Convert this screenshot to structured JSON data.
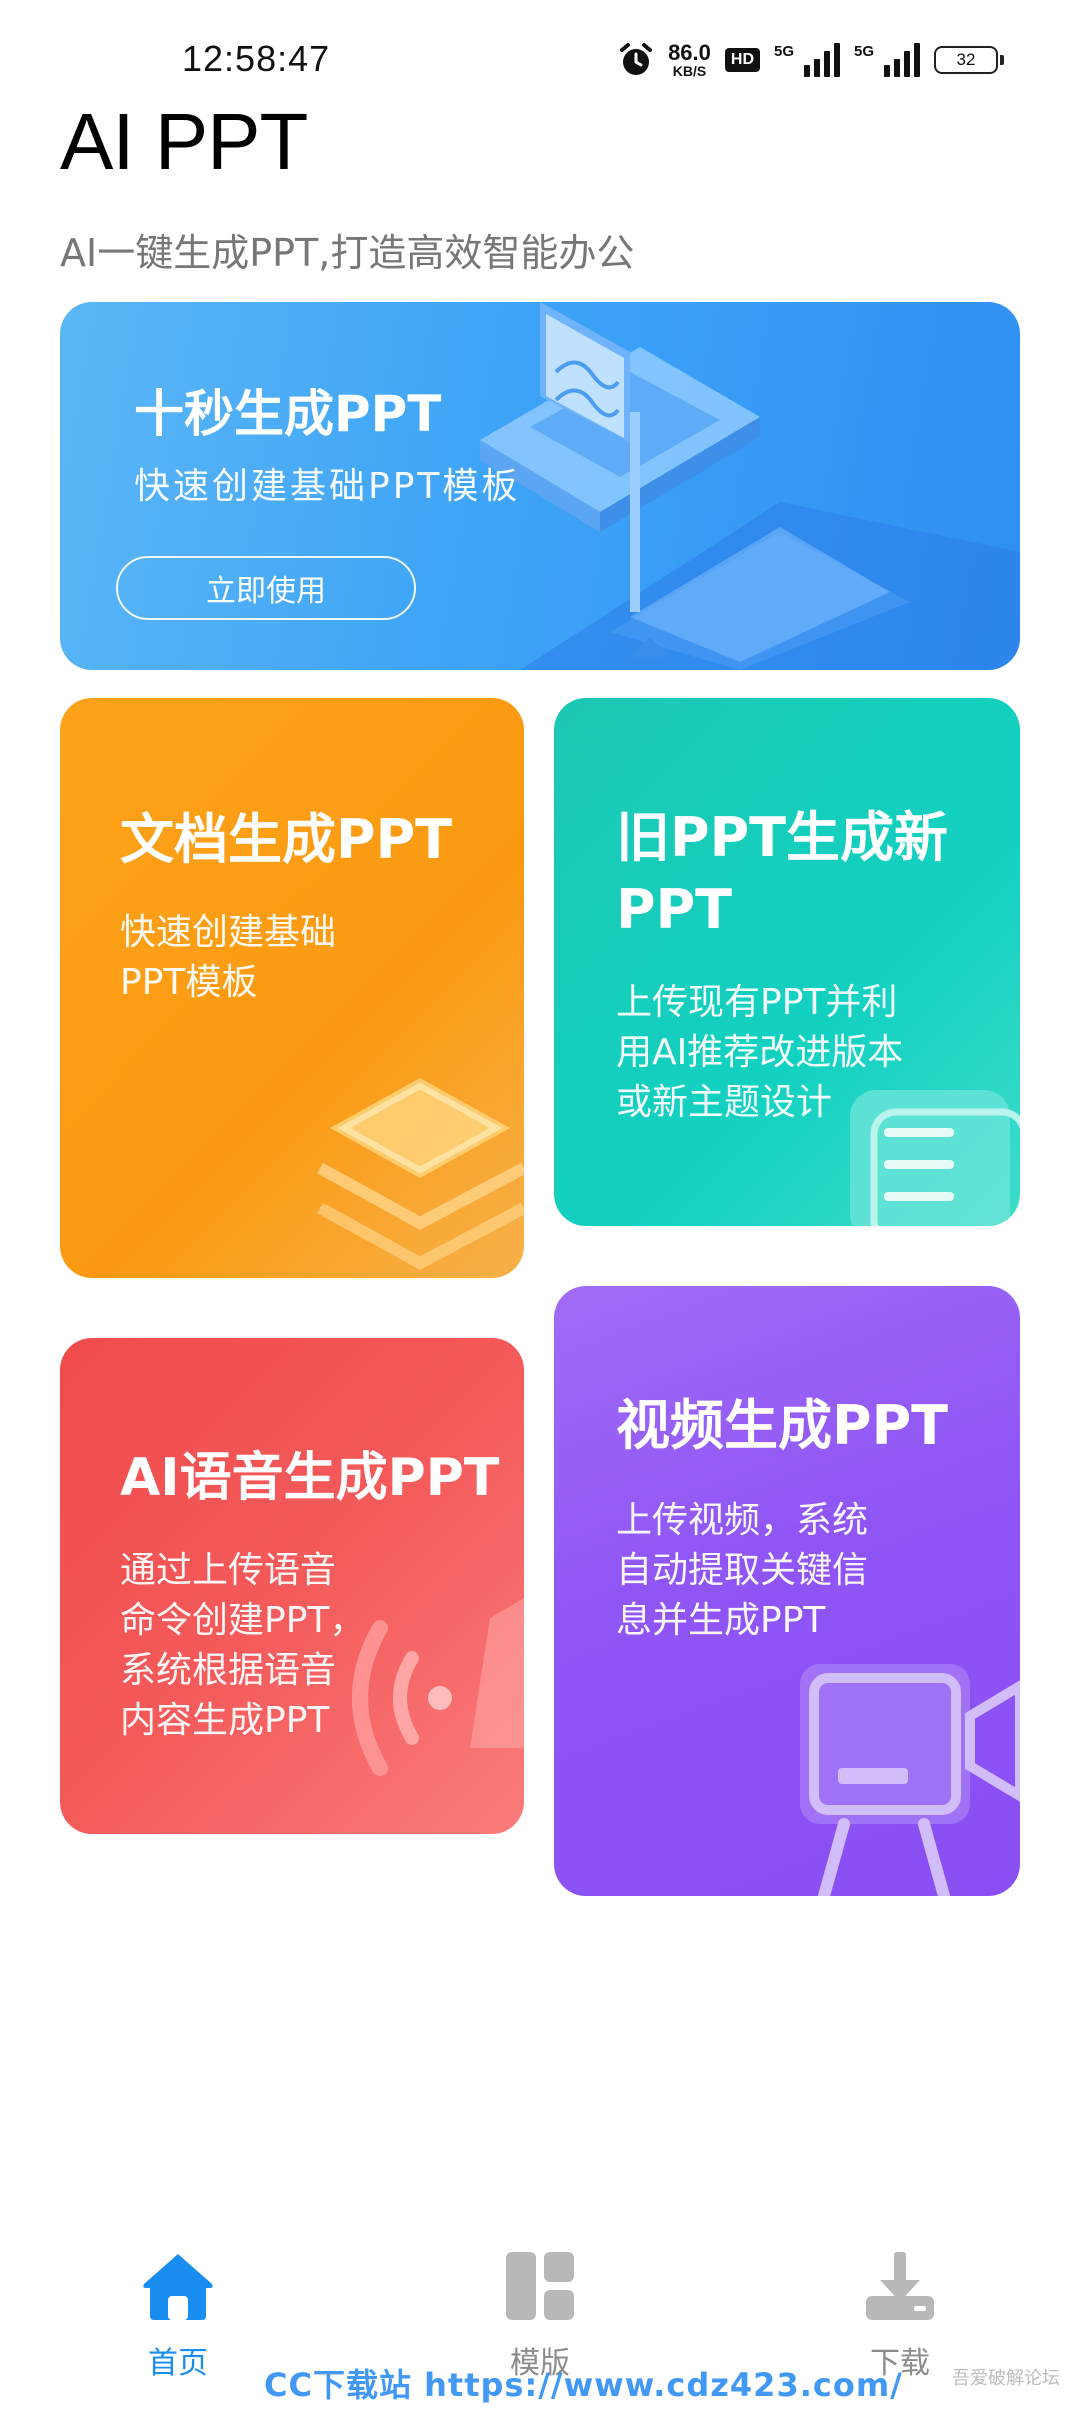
{
  "status_bar": {
    "time": "12:58:47",
    "net_speed_value": "86.0",
    "net_speed_unit": "KB/S",
    "hd_label": "HD",
    "signal1_label": "5G",
    "signal2_label": "5G",
    "battery_level": "32"
  },
  "header": {
    "title": "AI PPT",
    "subtitle": "AI一键生成PPT,打造高效智能办公"
  },
  "banner": {
    "title": "十秒生成PPT",
    "description": "快速创建基础PPT模板",
    "button_label": "立即使用",
    "icon": "presentation-board-icon"
  },
  "cards": {
    "doc": {
      "title": "文档生成PPT",
      "description": "快速创建基础\nPPT模板",
      "icon": "layers-icon"
    },
    "old_ppt": {
      "title": "旧PPT生成新\nPPT",
      "description": "上传现有PPT并利\n用AI推荐改进版本\n或新主题设计",
      "icon": "document-icon"
    },
    "voice": {
      "title": "AI语音生成PPT",
      "description": "通过上传语音\n命令创建PPT，\n系统根据语音\n内容生成PPT",
      "icon": "sound-wave-icon"
    },
    "video": {
      "title": "视频生成PPT",
      "description": "上传视频，系统\n自动提取关键信\n息并生成PPT",
      "icon": "video-camera-icon"
    }
  },
  "bottom_nav": {
    "items": [
      {
        "label": "首页",
        "icon": "home-icon",
        "active": true
      },
      {
        "label": "模版",
        "icon": "grid-icon",
        "active": false
      },
      {
        "label": "下载",
        "icon": "download-icon",
        "active": false
      }
    ]
  },
  "watermark": {
    "text": "CC下载站 https://www.cdz423.com/",
    "corner_text": "吾爱破解论坛"
  },
  "colors": {
    "accent": "#1a8ef0",
    "banner": "#3ea4f7",
    "doc": "#fb9a12",
    "old_ppt": "#12d1c1",
    "voice": "#f45a5a",
    "video": "#8f55f5",
    "nav_inactive": "#b8b8b8"
  }
}
